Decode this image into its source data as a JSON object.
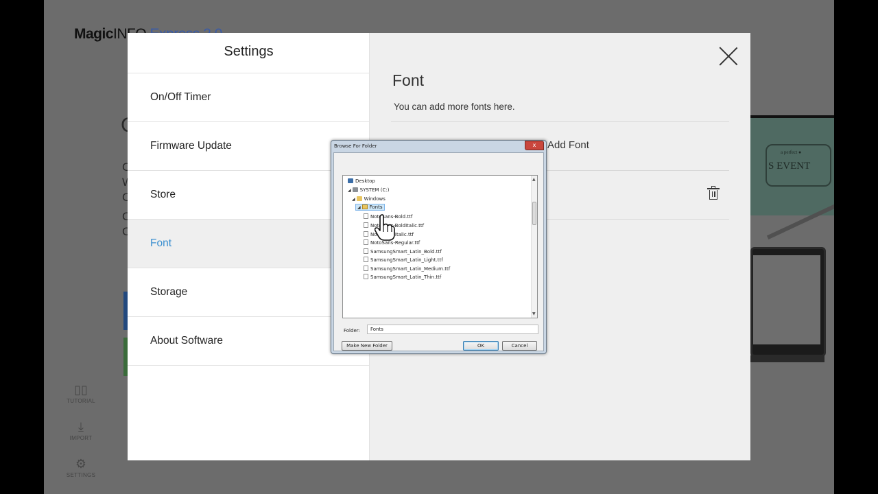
{
  "app": {
    "logo_bold": "Magic",
    "logo_light": "INFO",
    "logo_product": "Express",
    "logo_version": "2.0"
  },
  "background": {
    "letters": [
      "C",
      "C",
      "W",
      "C",
      "C",
      "C"
    ],
    "sidebar": [
      {
        "label": "TUTORIAL",
        "icon": "book-icon"
      },
      {
        "label": "IMPORT",
        "icon": "download-icon"
      },
      {
        "label": "SETTINGS",
        "icon": "gear-icon"
      }
    ],
    "banner_text": "S EVENT",
    "banner_small": "a perfect ●",
    "colors": {
      "tile_blue": "#23497e",
      "tile_green": "#3a6b3a",
      "teal": "#4f6a62"
    }
  },
  "settings": {
    "title": "Settings",
    "menu": [
      {
        "label": "On/Off Timer",
        "active": false
      },
      {
        "label": "Firmware Update",
        "active": false
      },
      {
        "label": "Store",
        "active": false
      },
      {
        "label": "Font",
        "active": true
      },
      {
        "label": "Storage",
        "active": false
      },
      {
        "label": "About Software",
        "active": false
      }
    ],
    "accent_color": "#3a8fd0",
    "content": {
      "title": "Font",
      "description": "You can add more fonts here.",
      "add_font_label": "Add Font",
      "close_icon": "close-icon",
      "delete_icon": "trash-icon"
    }
  },
  "dialog": {
    "title": "Browse For Folder",
    "close_glyph": "x",
    "tree": [
      {
        "label": "Desktop",
        "icon": "desktop-icon",
        "twisty": ""
      },
      {
        "label": "SYSTEM (C:)",
        "icon": "drive-icon",
        "twisty": "◢"
      },
      {
        "label": "Windows",
        "icon": "folder-icon",
        "twisty": "◢"
      },
      {
        "label": "Fonts",
        "icon": "font-folder-icon",
        "twisty": "◢",
        "selected": true
      },
      {
        "label": "NotoSans-Bold.ttf",
        "icon": "font-file-icon"
      },
      {
        "label": "NotoSans-BoldItalic.ttf",
        "icon": "font-file-icon"
      },
      {
        "label": "NotoSans-Italic.ttf",
        "icon": "font-file-icon"
      },
      {
        "label": "NotoSans-Regular.ttf",
        "icon": "font-file-icon"
      },
      {
        "label": "SamsungSmart_Latin_Bold.ttf",
        "icon": "font-file-icon"
      },
      {
        "label": "SamsungSmart_Latin_Light.ttf",
        "icon": "font-file-icon"
      },
      {
        "label": "SamsungSmart_Latin_Medium.ttf",
        "icon": "font-file-icon"
      },
      {
        "label": "SamsungSmart_Latin_Thin.ttf",
        "icon": "font-file-icon"
      }
    ],
    "folder_label": "Folder:",
    "folder_value": "Fonts",
    "make_new_folder_label": "Make New Folder",
    "ok_label": "OK",
    "cancel_label": "Cancel"
  },
  "cursor": {
    "icon": "hand-pointer-icon"
  }
}
